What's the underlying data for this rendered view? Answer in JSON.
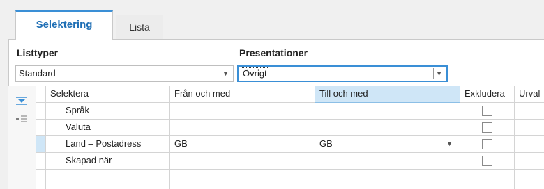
{
  "tabs": [
    {
      "label": "Selektering",
      "active": true
    },
    {
      "label": "Lista",
      "active": false
    }
  ],
  "listtyper": {
    "label": "Listtyper",
    "value": "Standard"
  },
  "presentationer": {
    "label": "Presentationer",
    "value": "Övrigt"
  },
  "grid": {
    "columns": {
      "selektera": "Selektera",
      "fran": "Från och med",
      "till": "Till och med",
      "exkludera": "Exkludera",
      "urval": "Urval"
    },
    "rows": [
      {
        "label": "Språk",
        "fran": "",
        "till": "",
        "exkludera": false
      },
      {
        "label": "Valuta",
        "fran": "",
        "till": "",
        "exkludera": false
      },
      {
        "label": "Land – Postadress",
        "fran": "GB",
        "till": "GB",
        "exkludera": false
      },
      {
        "label": "Skapad när",
        "fran": "",
        "till": "",
        "exkludera": false
      }
    ]
  },
  "icons": {
    "move_down": "move-down-icon",
    "collapse": "collapse-icon"
  },
  "colors": {
    "accent": "#3a8fd6",
    "tab_text": "#1f6fb5",
    "selected_header": "#cfe6f7"
  }
}
